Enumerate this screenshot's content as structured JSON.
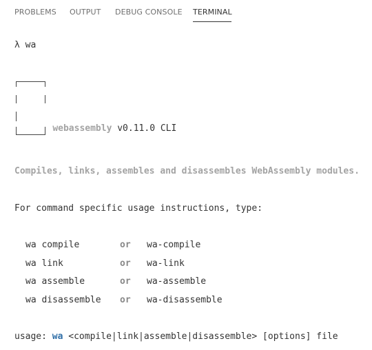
{
  "tabs": [
    {
      "label": "PROBLEMS"
    },
    {
      "label": "OUTPUT"
    },
    {
      "label": "DEBUG CONSOLE"
    },
    {
      "label": "TERMINAL"
    }
  ],
  "active_tab": "TERMINAL",
  "terminal": {
    "prompt_line": "λ wa",
    "banner": {
      "name": "webassembly",
      "version": "v0.11.0 CLI"
    },
    "description": "Compiles, links, assembles and disassembles WebAssembly modules.",
    "usage_intro": "For command specific usage instructions, type:",
    "commands": [
      {
        "left": "wa compile",
        "or": "or",
        "right": "wa-compile"
      },
      {
        "left": "wa link",
        "or": "or",
        "right": "wa-link"
      },
      {
        "left": "wa assemble",
        "or": "or",
        "right": "wa-assemble"
      },
      {
        "left": "wa disassemble",
        "or": "or",
        "right": "wa-disassemble"
      }
    ],
    "usage": {
      "prefix": "usage: ",
      "command": "wa",
      "args": " <compile|link|assemble|disassemble> [options] file"
    }
  },
  "colors": {
    "muted": "#a3a3a3",
    "accent_blue": "#2f6ea7",
    "text": "#333333"
  }
}
